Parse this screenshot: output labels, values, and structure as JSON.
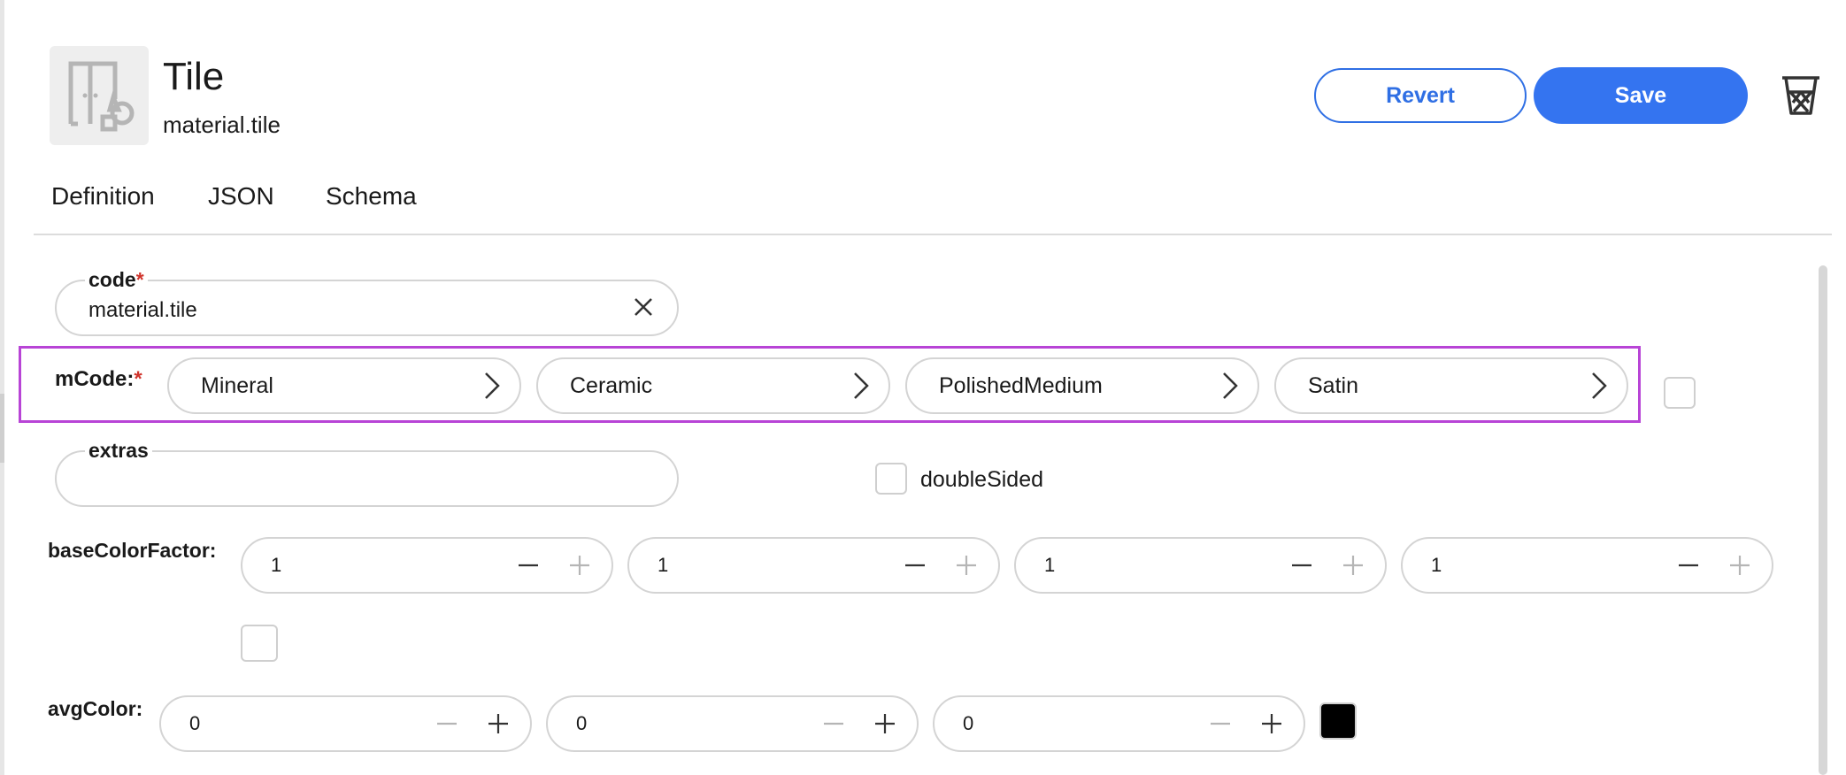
{
  "header": {
    "title": "Tile",
    "subtitle": "material.tile",
    "revert_label": "Revert",
    "save_label": "Save"
  },
  "tabs": [
    {
      "label": "Definition"
    },
    {
      "label": "JSON"
    },
    {
      "label": "Schema"
    }
  ],
  "form": {
    "code": {
      "label": "code",
      "required_mark": "*",
      "value": "material.tile"
    },
    "mcode": {
      "label": "mCode:",
      "required_mark": "*",
      "segments": [
        "Mineral",
        "Ceramic",
        "PolishedMedium",
        "Satin"
      ]
    },
    "extras": {
      "label": "extras",
      "value": ""
    },
    "double_sided": {
      "label": "doubleSided",
      "checked": false
    },
    "base_color_factor": {
      "label": "baseColorFactor:",
      "values": [
        "1",
        "1",
        "1",
        "1"
      ]
    },
    "avg_color": {
      "label": "avgColor:",
      "values": [
        "0",
        "0",
        "0"
      ],
      "swatch_color": "#000000"
    }
  },
  "colors": {
    "accent": "#3474f0",
    "highlight_border": "#b844d6",
    "required": "#d0342c"
  },
  "icons": {
    "thumbnail": "tile-material-icon",
    "clear": "close-icon",
    "chevron": "chevron-right-icon",
    "minus": "minus-icon",
    "plus": "plus-icon",
    "delete": "trash-icon"
  }
}
